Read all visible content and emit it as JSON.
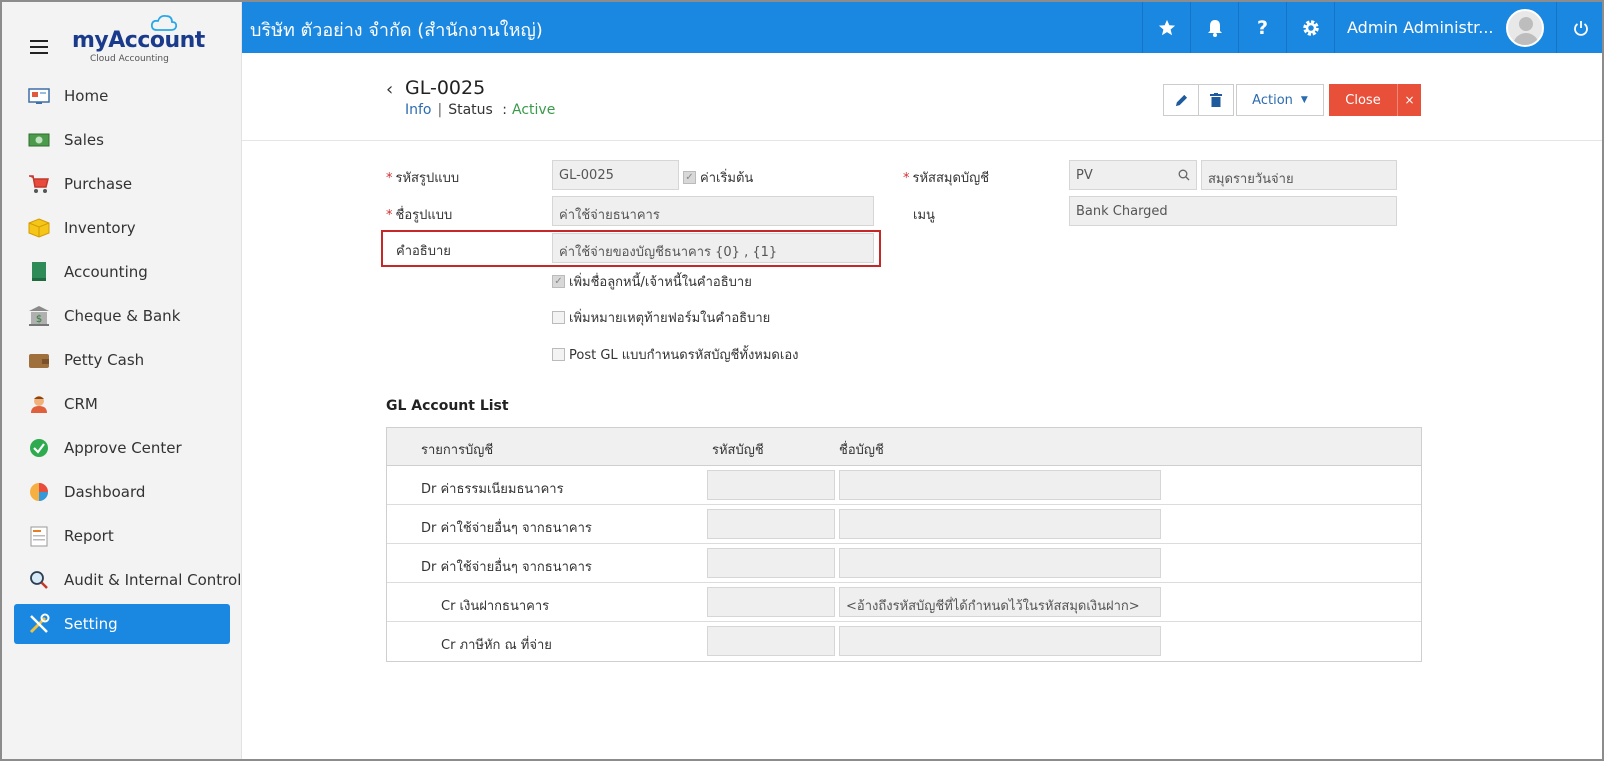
{
  "sidebar": {
    "logo_brand": "myAccount",
    "logo_sub": "Cloud Accounting",
    "items": [
      {
        "label": "Home",
        "icon": "home-icon"
      },
      {
        "label": "Sales",
        "icon": "sales-icon"
      },
      {
        "label": "Purchase",
        "icon": "cart-icon"
      },
      {
        "label": "Inventory",
        "icon": "box-icon"
      },
      {
        "label": "Accounting",
        "icon": "book-icon"
      },
      {
        "label": "Cheque & Bank",
        "icon": "bank-icon"
      },
      {
        "label": "Petty Cash",
        "icon": "wallet-icon"
      },
      {
        "label": "CRM",
        "icon": "person-icon"
      },
      {
        "label": "Approve Center",
        "icon": "check-circle-icon"
      },
      {
        "label": "Dashboard",
        "icon": "pie-chart-icon"
      },
      {
        "label": "Report",
        "icon": "report-icon"
      },
      {
        "label": "Audit & Internal Control",
        "icon": "magnifier-icon"
      },
      {
        "label": "Setting",
        "icon": "tools-icon",
        "active": true
      }
    ]
  },
  "topbar": {
    "company": "บริษัท ตัวอย่าง จำกัด (สำนักงานใหญ่)",
    "user_name": "Admin Administr..."
  },
  "header": {
    "title": "GL-0025",
    "info_link": "Info",
    "separator": "|",
    "status_label": "Status",
    "status_colon": ":",
    "status_value": "Active",
    "action_label": "Action",
    "close_label": "Close",
    "x_label": "×"
  },
  "form": {
    "code_label": "รหัสรูปแบบ",
    "code_value": "GL-0025",
    "default_label": "ค่าเริ่มต้น",
    "name_label": "ชื่อรูปแบบ",
    "name_value": "ค่าใช้จ่ายธนาคาร",
    "desc_label": "คำอธิบาย",
    "desc_value": "ค่าใช้จ่ายของบัญชีธนาคาร {0} , {1}",
    "journal_label": "รหัสสมุดบัญชี",
    "journal_code": "PV",
    "journal_name": "สมุดรายวันจ่าย",
    "menu_label": "เมนู",
    "menu_value": "Bank Charged",
    "opt1": "เพิ่มชื่อลูกหนี้/เจ้าหนี้ในคำอธิบาย",
    "opt2": "เพิ่มหมายเหตุท้ายฟอร์มในคำอธิบาย",
    "opt3": "Post GL แบบกำหนดรหัสบัญชีทั้งหมดเอง"
  },
  "gl_list": {
    "title": "GL Account List",
    "headers": [
      "รายการบัญชี",
      "รหัสบัญชี",
      "ชื่อบัญชี"
    ],
    "rows": [
      {
        "name": "Dr ค่าธรรมเนียมธนาคาร",
        "account": ""
      },
      {
        "name": "Dr ค่าใช้จ่ายอื่นๆ จากธนาคาร",
        "account": ""
      },
      {
        "name": "Dr ค่าใช้จ่ายอื่นๆ จากธนาคาร",
        "account": ""
      },
      {
        "name": "Cr เงินฝากธนาคาร",
        "account": "<อ้างถึงรหัสบัญชีที่ได้กำหนดไว้ในรหัสสมุดเงินฝาก>"
      },
      {
        "name": "Cr ภาษีหัก ณ ที่จ่าย",
        "account": ""
      }
    ]
  },
  "colors": {
    "primary": "#1a87e0",
    "close_button": "#e8503a",
    "active_status": "#3a9a4a",
    "highlight": "#c62828"
  }
}
